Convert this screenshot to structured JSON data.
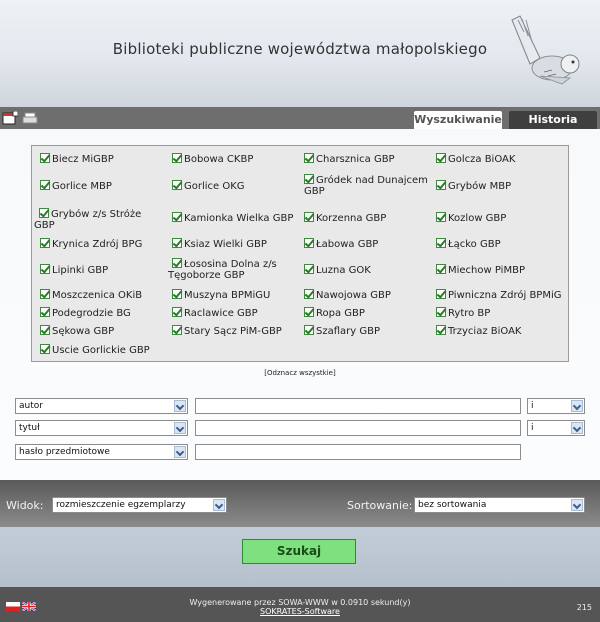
{
  "header": {
    "title": "Biblioteki publiczne województwa małopolskiego"
  },
  "tabs": {
    "search": "Wyszukiwanie",
    "history": "Historia"
  },
  "libraries": [
    "Biecz MiGBP",
    "Bobowa CKBP",
    "Charsznica GBP",
    "Golcza BiOAK",
    "Gorlice MBP",
    "Gorlice OKG",
    "Gródek nad Dunajcem GBP",
    "Grybów MBP",
    "Grybów z/s Stróże GBP",
    "Kamionka Wielka GBP",
    "Korzenna GBP",
    "Kozlow GBP",
    "Krynica Zdrój BPG",
    "Ksiaz Wielki GBP",
    "Łabowa GBP",
    "Łącko GBP",
    "Lipinki GBP",
    "Łososina Dolna z/s Tęgoborze GBP",
    "Luzna GOK",
    "Miechow PiMBP",
    "Moszczenica OKiB",
    "Muszyna BPMiGU",
    "Nawojowa GBP",
    "Piwniczna Zdrój BPMiG",
    "Podegrodzie BG",
    "Raclawice GBP",
    "Ropa GBP",
    "Rytro BP",
    "Sękowa GBP",
    "Stary Sącz PiM-GBP",
    "Szaflary GBP",
    "Trzyciaz BiOAK",
    "Uscie Gorlickie GBP"
  ],
  "unmark_all": "[Odznacz wszystkie]",
  "search_rows": [
    {
      "field": "autor",
      "operator": "i"
    },
    {
      "field": "tytuł",
      "operator": "i"
    },
    {
      "field": "hasło przedmiotowe"
    }
  ],
  "view": {
    "label": "Widok:",
    "value": "rozmieszczenie egzemplarzy"
  },
  "sort": {
    "label": "Sortowanie:",
    "value": "bez sortowania"
  },
  "search_button": "Szukaj",
  "footer": {
    "generated": "Wygenerowane przez SOWA-WWW w 0.0910 sekund(y)",
    "link": "SOKRATES-Software",
    "count": "215"
  }
}
